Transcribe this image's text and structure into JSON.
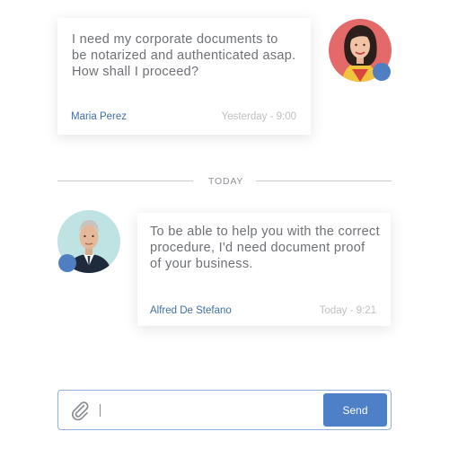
{
  "messages": [
    {
      "text": "I  need my corporate documents to be notarized and authenticated asap. How shall I proceed?",
      "sender": "Maria Perez",
      "time": "Yesterday - 9:00"
    },
    {
      "text": "To be able to help you with the correct procedure, I'd need document proof of your business.",
      "sender": "Alfred De Stefano",
      "time": "Today - 9:21"
    }
  ],
  "divider": {
    "label": "TODAY"
  },
  "composer": {
    "value": "",
    "placeholder": "",
    "send_label": "Send"
  },
  "colors": {
    "accent": "#4d80c6",
    "sender_name": "#3d6fa8",
    "online_dot": "#4f7ec3"
  },
  "icons": {
    "attach": "paperclip-icon",
    "status": "online-status-icon"
  }
}
